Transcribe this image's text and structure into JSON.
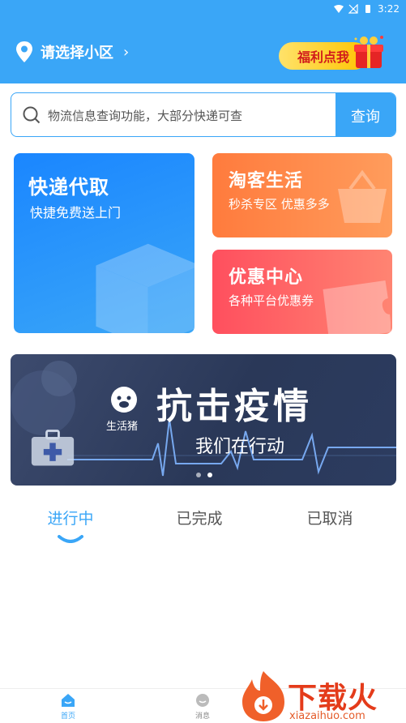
{
  "status_bar": {
    "time": "3:22"
  },
  "header": {
    "location_text": "请选择小区",
    "location_chevron": "›",
    "welfare_label": "福利点我"
  },
  "search": {
    "placeholder": "物流信息查询功能，大部分快递可查",
    "button_label": "查询"
  },
  "cards": {
    "express": {
      "title": "快递代取",
      "subtitle": "快捷免费送上门"
    },
    "taoke": {
      "title": "淘客生活",
      "subtitle": "秒杀专区  优惠多多"
    },
    "coupon": {
      "title": "优惠中心",
      "subtitle": "各种平台优惠券"
    }
  },
  "banner": {
    "logo_text": "生活猪",
    "slogan": "抗击疫情",
    "subtitle": "我们在行动",
    "slide_count": 2,
    "active_slide": 2
  },
  "tabs": [
    {
      "label": "进行中",
      "active": true
    },
    {
      "label": "已完成",
      "active": false
    },
    {
      "label": "已取消",
      "active": false
    }
  ],
  "bottom_nav": [
    {
      "label": "首页",
      "active": true
    },
    {
      "label": "消息",
      "active": false
    }
  ],
  "watermark": {
    "brand": "下载火",
    "url": "xiazaihuo.com"
  },
  "colors": {
    "primary": "#3aa6f7",
    "taoke": "#ff8a4a",
    "coupon": "#ff5b64",
    "welfare": "#ffd23a"
  }
}
